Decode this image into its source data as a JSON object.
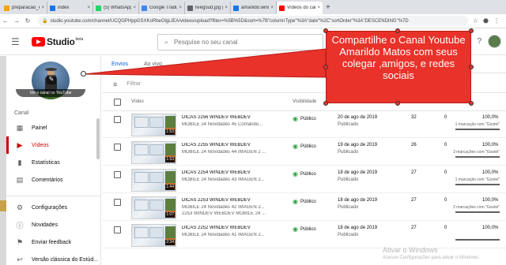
{
  "browser": {
    "tabs": [
      {
        "title": "preparacao_estudo",
        "color": "#f2a600",
        "active": false
      },
      {
        "title": "index",
        "color": "#1a73e8",
        "active": false
      },
      {
        "title": "(5) WhatsApp",
        "color": "#25d366",
        "active": false
      },
      {
        "title": "Google Tradutor",
        "color": "#4285f4",
        "active": false
      },
      {
        "title": "livegoud.jpg (11...",
        "color": "#5f6368",
        "active": false
      },
      {
        "title": "amarildo.windev",
        "color": "#1a73e8",
        "active": false
      },
      {
        "title": "Vídeos do canal -",
        "color": "#ff0000",
        "active": true
      }
    ],
    "new_tab": "+",
    "url": "studio.youtube.com/channel/UCQGPHppGSXKoRbeOlgLIEA/videos/upload?filter=%5B%5D&sort=%7B\"columnType\"%3A\"date\"%2C\"sortOrder\"%3A\"DESCENDING\"%7D",
    "back": "←",
    "forward": "→",
    "reload": "↻"
  },
  "header": {
    "menu_icon": "menu-icon",
    "logo_text": "Studio",
    "logo_badge": "beta",
    "search_placeholder": "Pesquise no seu canal"
  },
  "sidebar": {
    "view_channel": "Ver o canal no YouTube",
    "section_label": "Canal",
    "items": [
      {
        "label": "Painel",
        "icon": "dashboard-icon",
        "glyph": "▦",
        "active": false
      },
      {
        "label": "Vídeos",
        "icon": "videos-icon",
        "glyph": "▶",
        "active": true
      },
      {
        "label": "Estatísticas",
        "icon": "analytics-icon",
        "glyph": "▮",
        "active": false
      },
      {
        "label": "Comentários",
        "icon": "comments-icon",
        "glyph": "▤",
        "active": false
      },
      {
        "label": "Configurações",
        "icon": "settings-icon",
        "glyph": "⚙",
        "active": false
      },
      {
        "label": "Novidades",
        "icon": "whats-new-icon",
        "glyph": "ⓘ",
        "active": false
      },
      {
        "label": "Enviar feedback",
        "icon": "feedback-icon",
        "glyph": "⚑",
        "active": false
      },
      {
        "label": "Versão clássica do Estúd...",
        "icon": "classic-icon",
        "glyph": "↩",
        "active": false
      }
    ]
  },
  "main": {
    "tabs": [
      {
        "label": "Envios",
        "active": true
      },
      {
        "label": "Ao vivo",
        "active": false
      }
    ],
    "filter_label": "Filtrar",
    "columns": {
      "video": "Vídeo",
      "visibility": "Visibilidade",
      "date": "Data",
      "views": "Visualizações",
      "comments": "Comentários",
      "likes": "Marcações \"Gostei\""
    },
    "rows": [
      {
        "title": "DICAS 2256 WINDEV WEBDEV",
        "desc1": "MOBILE 24 Novidades 45 Comando...",
        "desc2": "",
        "duration": "1:53",
        "visibility": "Público",
        "date": "20 de ago de 2019",
        "status": "Publicado",
        "views": "32",
        "comments": "0",
        "likes": "100,0%",
        "likes_sub": "1 marcação com \"Gostei\"",
        "likes_ratio": 1.0
      },
      {
        "title": "DICAS 2255 WINDEV WEBDEV",
        "desc1": "MOBILE 24 Novidades 44 IMAGEN 2 ...",
        "desc2": "",
        "duration": "1:53",
        "visibility": "Público",
        "date": "19 de ago de 2019",
        "status": "Publicado",
        "views": "26",
        "comments": "0",
        "likes": "100,0%",
        "likes_sub": "3 marcações com \"Gostei\"",
        "likes_ratio": 1.0
      },
      {
        "title": "DICAS 2254 WINDEV WEBDEV",
        "desc1": "MOBILE 24 Novidades 43 IMAGEN 2...",
        "desc2": "",
        "duration": "1:44",
        "visibility": "Público",
        "date": "18 de ago de 2019",
        "status": "Publicado",
        "views": "27",
        "comments": "0",
        "likes": "100,0%",
        "likes_sub": "1 marcação com \"Gostei\"",
        "likes_ratio": 1.0
      },
      {
        "title": "DICAS 2253 WINDEV WEBDEV",
        "desc1": "MOBILE 24 Novidades 42 IMAGEN 2...",
        "desc2": "2253 WINDEV WEBDEV MOBILE 24 ...",
        "duration": "1:07",
        "visibility": "Público",
        "date": "18 de ago de 2019",
        "status": "Publicado",
        "views": "27",
        "comments": "0",
        "likes": "100,0%",
        "likes_sub": "2 marcações com \"Gostei\"",
        "likes_ratio": 1.0
      },
      {
        "title": "DICAS 2252 WINDEV WEBDEV",
        "desc1": "MOBILE 24 Novidades 41 IMAGEN 2...",
        "desc2": "",
        "duration": "2:34",
        "visibility": "Público",
        "date": "18 de ago de 2019",
        "status": "Publicado",
        "views": "27",
        "comments": "0",
        "likes": "100,0%",
        "likes_sub": "",
        "likes_ratio": 1.0
      }
    ]
  },
  "callout": {
    "text": "Compartilhe o Canal Youtube Amarildo Matos com seus colegar ,amigos, e redes sociais",
    "color": "#e8322a"
  },
  "watermark": {
    "line1": "Ativar o Windows",
    "line2": "Acesse Configurações para ativar o Windows."
  }
}
